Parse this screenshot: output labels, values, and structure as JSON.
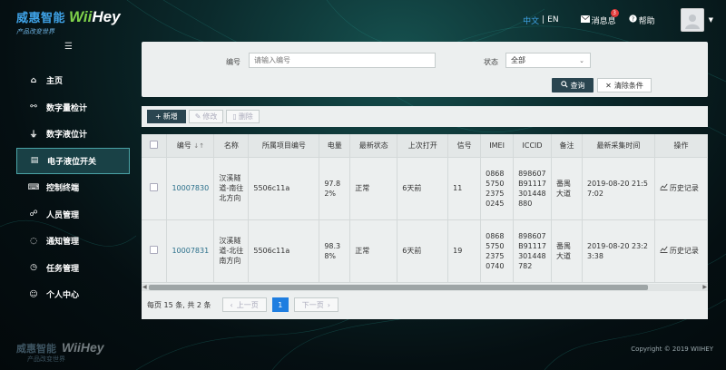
{
  "brand": {
    "name_cn": "威惠智能",
    "name_en_prefix": "Wii",
    "name_en_suffix": "Hey",
    "slogan": "产品改变世界"
  },
  "header": {
    "lang_active": "中文",
    "lang_sep": "|",
    "lang_other": "EN",
    "messages_label": "消息息",
    "messages_count": "3",
    "help_label": "帮助"
  },
  "sidebar": {
    "items": [
      {
        "label": "主页",
        "icon": "home-icon"
      },
      {
        "label": "数字量检计",
        "icon": "link-icon"
      },
      {
        "label": "数字液位计",
        "icon": "gauge-icon"
      },
      {
        "label": "电子液位开关",
        "icon": "document-icon"
      },
      {
        "label": "控制终端",
        "icon": "keyboard-icon"
      },
      {
        "label": "人员管理",
        "icon": "users-icon"
      },
      {
        "label": "通知管理",
        "icon": "chat-icon"
      },
      {
        "label": "任务管理",
        "icon": "clock-icon"
      },
      {
        "label": "个人中心",
        "icon": "user-icon"
      }
    ]
  },
  "query": {
    "code_label": "编号",
    "code_placeholder": "请输入编号",
    "status_label": "状态",
    "status_value": "全部",
    "search_label": "查询",
    "clear_label": "清除条件"
  },
  "toolbar": {
    "add_label": "新增",
    "edit_label": "修改",
    "delete_label": "删除"
  },
  "table": {
    "headers": [
      "编号",
      "名称",
      "所属项目编号",
      "电量",
      "最新状态",
      "上次打开",
      "信号",
      "IMEI",
      "ICCID",
      "备注",
      "最新采集时间",
      "操作"
    ],
    "sort_marker": "↓↑",
    "rows": [
      {
        "code": "10007830",
        "name": "汉溪隧道-南往北方向",
        "project": "5506c11a",
        "battery": "97.82%",
        "status": "正常",
        "last_open": "6天前",
        "signal": "11",
        "imei": "0868575023750245",
        "iccid": "898607B91117301448880",
        "remark": "番禺大道",
        "time": "2019-08-20 21:57:02",
        "action": "历史记录"
      },
      {
        "code": "10007831",
        "name": "汉溪隧道-北往南方向",
        "project": "5506c11a",
        "battery": "98.38%",
        "status": "正常",
        "last_open": "6天前",
        "signal": "19",
        "imei": "0868575023750740",
        "iccid": "898607B91117301448782",
        "remark": "番禺大道",
        "time": "2019-08-20 23:23:38",
        "action": "历史记录"
      }
    ]
  },
  "pager": {
    "summary": "每页 15 条, 共 2 条",
    "prev_label": "上一页",
    "current_page": "1",
    "next_label": "下一页"
  },
  "footer": {
    "copyright": "Copyright © 2019 WIIHEY"
  }
}
